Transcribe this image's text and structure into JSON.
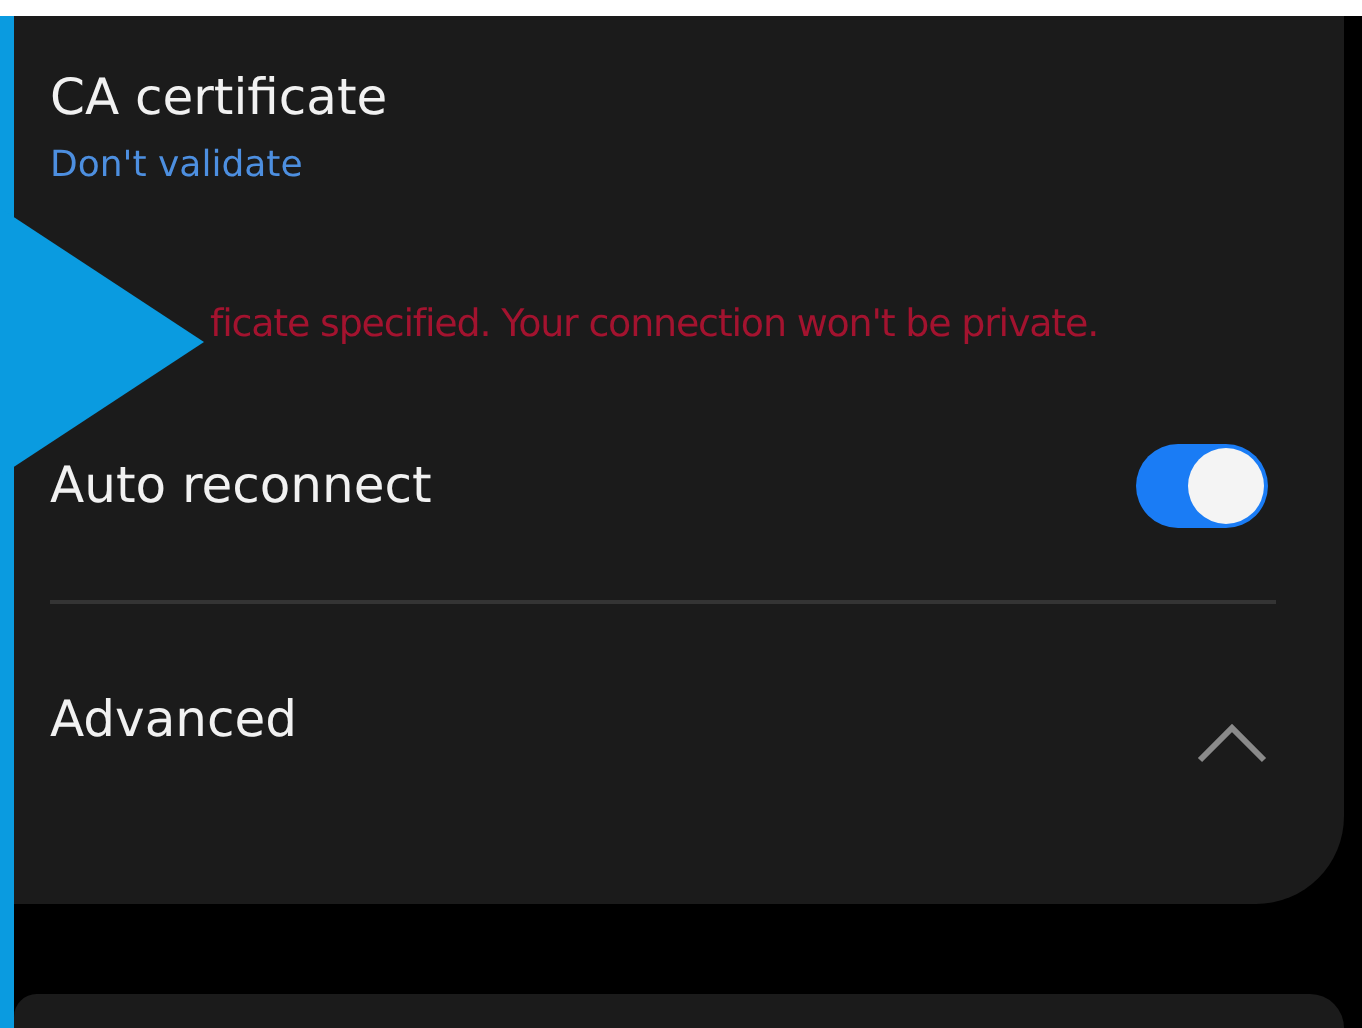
{
  "ca_certificate": {
    "label": "CA certificate",
    "value": "Don't validate"
  },
  "warning": "ficate specified. Your connection won't be private.",
  "auto_reconnect": {
    "label": "Auto reconnect",
    "on": true
  },
  "advanced": {
    "label": "Advanced",
    "expanded": true
  }
}
